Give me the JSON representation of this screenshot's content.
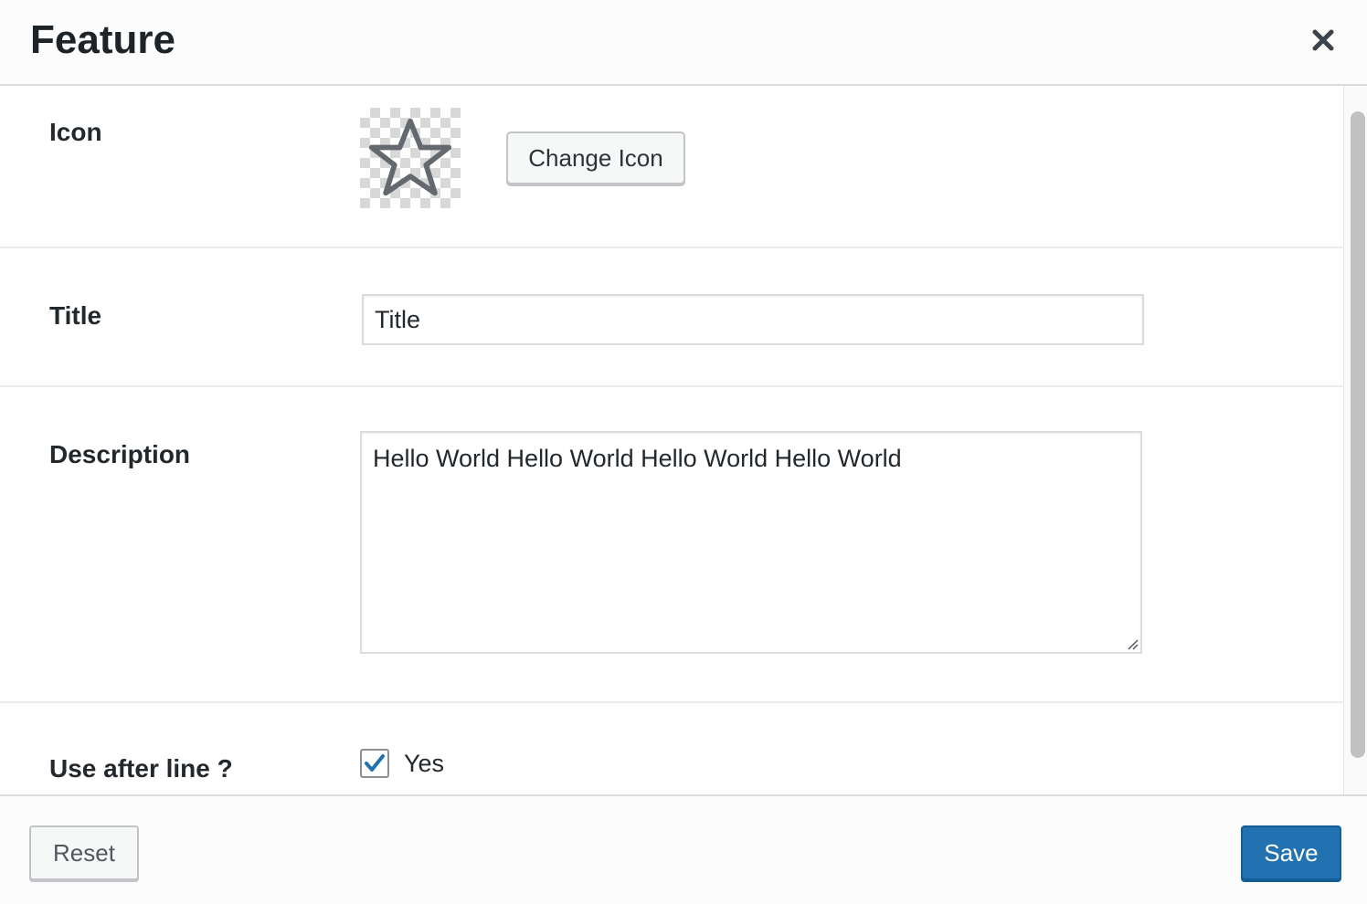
{
  "header": {
    "title": "Feature",
    "close_icon": "close-icon"
  },
  "fields": {
    "icon": {
      "label": "Icon",
      "preview_icon": "star-icon",
      "change_button_label": "Change Icon"
    },
    "title": {
      "label": "Title",
      "value": "Title"
    },
    "description": {
      "label": "Description",
      "value": "Hello World Hello World Hello World Hello World"
    },
    "use_after_line": {
      "label": "Use after line ?",
      "checked": true,
      "option_label": "Yes"
    }
  },
  "footer": {
    "reset_label": "Reset",
    "save_label": "Save"
  },
  "colors": {
    "primary": "#2271b1",
    "primary_border": "#135e96",
    "checkmark": "#2271b1"
  }
}
